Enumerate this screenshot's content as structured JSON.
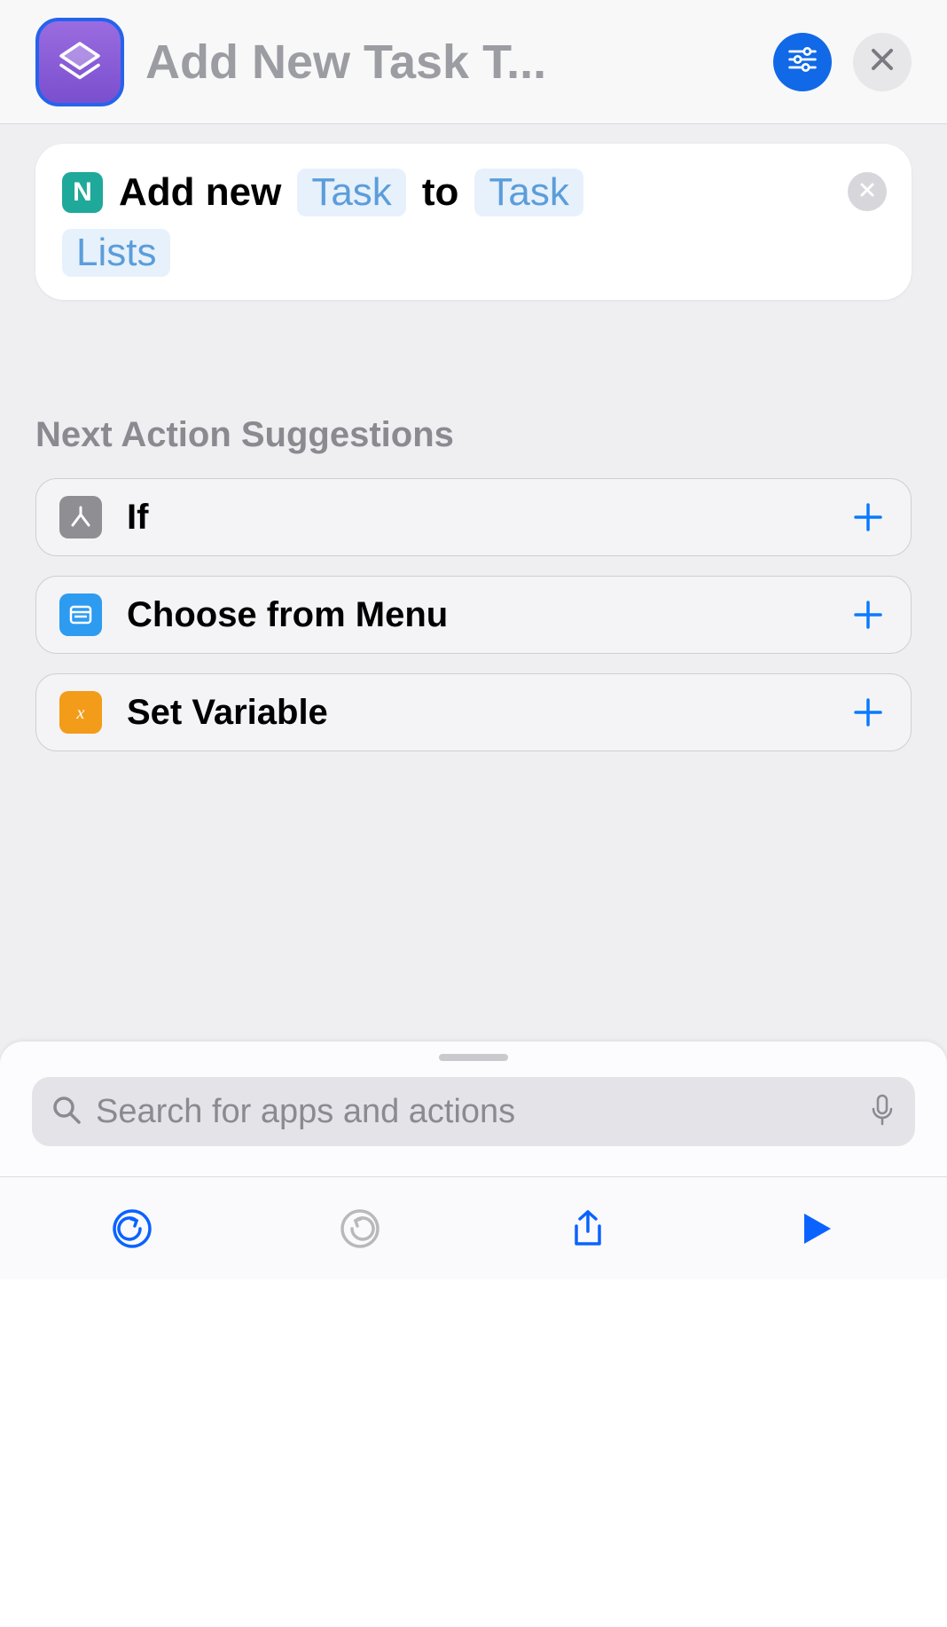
{
  "header": {
    "title": "Add New Task T...",
    "app_icon": "shortcuts-icon",
    "settings_icon": "sliders-icon",
    "close_icon": "close-icon"
  },
  "action": {
    "app_icon_letter": "N",
    "prefix": "Add new",
    "param1": "Task",
    "connector": "to",
    "param2": "Task",
    "param2_continued": "Lists",
    "delete_icon": "x-icon"
  },
  "suggestions": {
    "heading": "Next Action Suggestions",
    "items": [
      {
        "label": "If",
        "icon_color": "gray",
        "icon": "branch-icon"
      },
      {
        "label": "Choose from Menu",
        "icon_color": "blue",
        "icon": "menu-icon"
      },
      {
        "label": "Set Variable",
        "icon_color": "orange",
        "icon": "variable-icon"
      }
    ]
  },
  "search": {
    "placeholder": "Search for apps and actions"
  },
  "toolbar": {
    "undo_icon": "undo-icon",
    "redo_icon": "redo-icon",
    "share_icon": "share-icon",
    "play_icon": "play-icon"
  }
}
